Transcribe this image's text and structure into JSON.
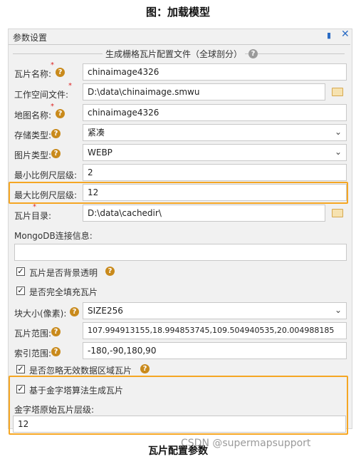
{
  "top_caption": "图：加载模型",
  "bottom_caption": "瓦片配置参数",
  "watermark": "CSDN @supermapsupport",
  "panel": {
    "title": "参数设置",
    "section_title": "生成栅格瓦片配置文件（全球剖分）",
    "fields": {
      "tile_name": {
        "label": "瓦片名称:",
        "value": "chinaimage4326"
      },
      "workspace_file": {
        "label": "工作空间文件:",
        "value": "D:\\data\\chinaimage.smwu"
      },
      "map_name": {
        "label": "地图名称:",
        "value": "chinaimage4326"
      },
      "storage_type": {
        "label": "存储类型:",
        "value": "紧凑"
      },
      "image_type": {
        "label": "图片类型:",
        "value": "WEBP"
      },
      "min_scale_level": {
        "label": "最小比例尺层级:",
        "value": "2"
      },
      "max_scale_level": {
        "label": "最大比例尺层级:",
        "value": "12"
      },
      "tile_dir": {
        "label": "瓦片目录:",
        "value": "D:\\data\\cachedir\\"
      },
      "mongodb_info": {
        "label": "MongoDB连接信息:",
        "value": ""
      },
      "block_size": {
        "label": "块大小(像素):",
        "value": "SIZE256"
      },
      "tile_range": {
        "label": "瓦片范围:",
        "value": "107.994913155,18.994853745,109.504940535,20.004988185"
      },
      "index_range": {
        "label": "索引范围:",
        "value": "-180,-90,180,90"
      },
      "pyramid_original_level": {
        "label": "金字塔原始瓦片层级:",
        "value": "12"
      }
    },
    "checkboxes": {
      "transparent_bg": {
        "label": "瓦片是否背景透明",
        "checked": true
      },
      "fully_filled": {
        "label": "是否完全填充瓦片",
        "checked": true
      },
      "ignore_invalid": {
        "label": "是否忽略无效数据区域瓦片",
        "checked": true
      },
      "pyramid_algorithm": {
        "label": "基于金字塔算法生成瓦片",
        "checked": true
      }
    },
    "glyphs": {
      "help": "?",
      "check": "✓",
      "chevron": "⌄",
      "pin": "▮",
      "close": "✕"
    }
  }
}
